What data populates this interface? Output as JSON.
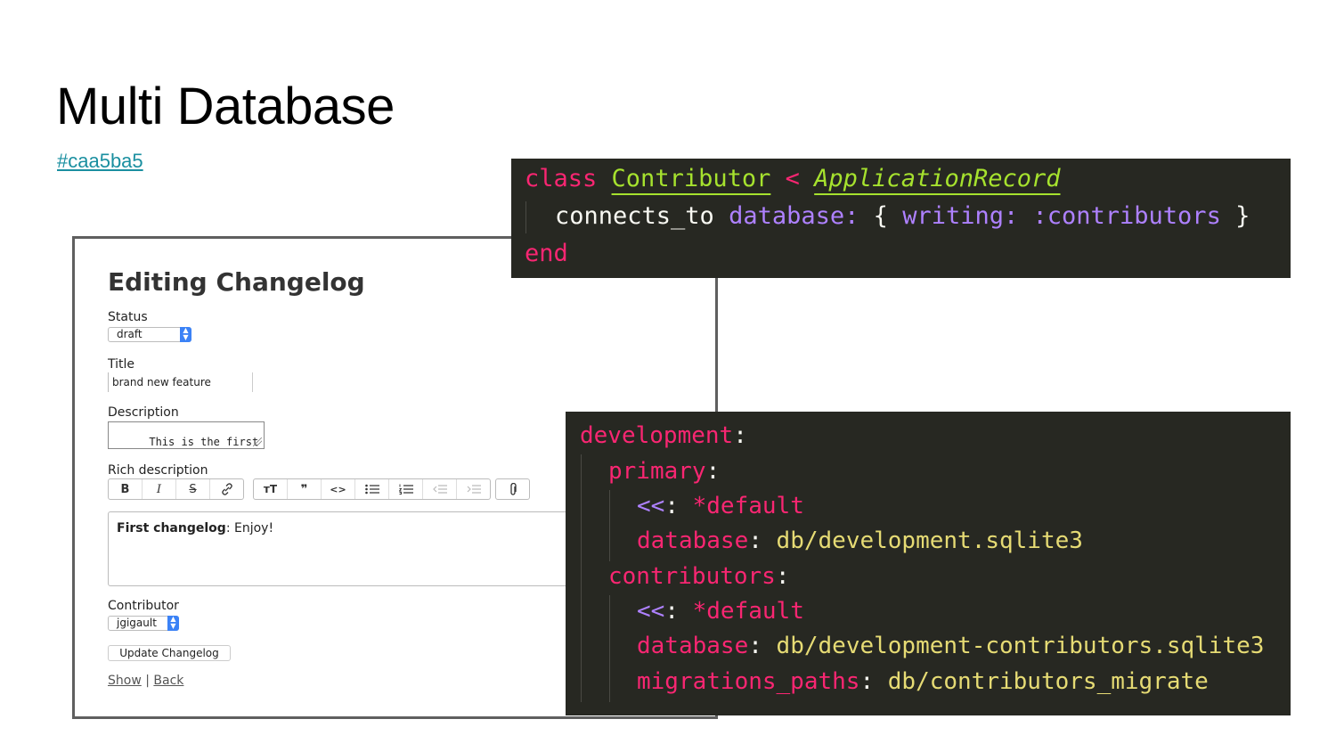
{
  "slide": {
    "title": "Multi Database",
    "link": "#caa5ba5"
  },
  "form": {
    "heading": "Editing Changelog",
    "status_label": "Status",
    "status_value": "draft",
    "title_label": "Title",
    "title_value": "brand new feature",
    "description_label": "Description",
    "description_value": "This is the first\nchangelog record,",
    "rich_label": "Rich description",
    "toolbar": {
      "bold": "B",
      "italic": "I",
      "strike": "S",
      "link": "🔗",
      "heading": "тT",
      "quote": "❞",
      "code": "<>",
      "bullets": "☰",
      "numbers": "☰",
      "outdent": "⇤",
      "indent": "⇥",
      "attach": "📎"
    },
    "rich_bold": "First changelog",
    "rich_rest": ": Enjoy!",
    "contributor_label": "Contributor",
    "contributor_value": "jgigault",
    "submit_label": "Update Changelog",
    "show_link": "Show",
    "separator": "|",
    "back_link": "Back"
  },
  "code_model": {
    "l1_kw": "class",
    "l1_class": "Contributor",
    "l1_op": "<",
    "l1_parent": "ApplicationRecord",
    "l2_method": "connects_to",
    "l2_key": "database:",
    "l2_brace_open": "{",
    "l2_key2": "writing:",
    "l2_sym": ":contributors",
    "l2_brace_close": "}",
    "l3_kw": "end"
  },
  "code_yaml": {
    "development": "development",
    "primary": "primary",
    "merge1": "<<",
    "alias1": "*default",
    "db_key1": "database",
    "db_val1": "db/development.sqlite3",
    "contributors": "contributors",
    "merge2": "<<",
    "alias2": "*default",
    "db_key2": "database",
    "db_val2": "db/development-contributors.sqlite3",
    "mig_key": "migrations_paths",
    "mig_val": "db/contributors_migrate"
  }
}
